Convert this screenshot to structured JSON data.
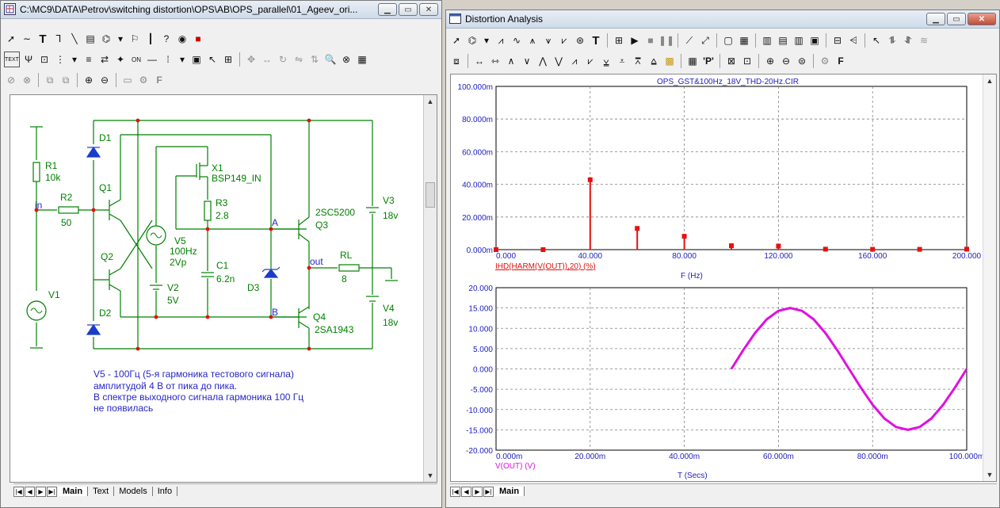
{
  "schematic_window": {
    "title": "C:\\MC9\\DATA\\Petrov\\switching distortion\\OPS\\AB\\OPS_parallel\\01_Ageev_ori...",
    "tabs": [
      "Main",
      "Text",
      "Models",
      "Info"
    ],
    "active_tab": "Main",
    "components": {
      "r1": "R1",
      "r1_val": "10k",
      "r2": "R2",
      "r2_val": "50",
      "d1": "D1",
      "d2": "D2",
      "q1": "Q1",
      "q2": "Q2",
      "x1": "X1",
      "x1_model": "BSP149_IN",
      "r3": "R3",
      "r3_val": "2.8",
      "v5": "V5",
      "v5_freq": "100Hz",
      "v5_amp": "2Vp",
      "v2": "V2",
      "v2_val": "5V",
      "c1": "C1",
      "c1_val": "6.2n",
      "d3": "D3",
      "q3": "Q3",
      "q3_model": "2SC5200",
      "q4": "Q4",
      "q4_model": "2SA1943",
      "v3": "V3",
      "v3_val": "18v",
      "v4": "V4",
      "v4_val": "18v",
      "rl": "RL",
      "rl_val": "8",
      "v1": "V1",
      "node_in": "in",
      "node_out": "out",
      "node_a": "A",
      "node_b": "B"
    },
    "note_lines": [
      "V5 - 100Гц (5-я гармоника тестового сигнала)",
      "амплитудой 4 В от пика до пика.",
      "В спектре выходного сигнала гармоника 100 Гц",
      "не появилась"
    ]
  },
  "analysis_window": {
    "title": "Distortion Analysis",
    "tabs": [
      "Main"
    ],
    "active_tab": "Main"
  },
  "chart_data": [
    {
      "type": "bar",
      "title": "OPS_GST&100Hz_18V_THD-20Hz.CIR",
      "xlabel": "F (Hz)",
      "ylabel": "IHD(HARM(V(OUT)),20) (%)",
      "xlim": [
        0,
        200
      ],
      "ylim": [
        0,
        0.1
      ],
      "x_ticks": [
        "0.000",
        "40.000",
        "80.000",
        "120.000",
        "160.000",
        "200.000"
      ],
      "y_ticks": [
        "0.000m",
        "20.000m",
        "40.000m",
        "60.000m",
        "80.000m",
        "100.000m"
      ],
      "x": [
        0,
        20,
        40,
        60,
        80,
        100,
        120,
        140,
        160,
        180,
        200
      ],
      "values": [
        0.0,
        0.0,
        0.0428,
        0.013,
        0.0082,
        0.0024,
        0.0022,
        0.0003,
        0.0002,
        0.0002,
        0.0003
      ],
      "color": "#e81010",
      "grid": true
    },
    {
      "type": "line",
      "xlabel": "T (Secs)",
      "ylabel": "V(OUT) (V)",
      "xlim": [
        0,
        0.1
      ],
      "ylim": [
        -20,
        20
      ],
      "x_ticks": [
        "0.000m",
        "20.000m",
        "40.000m",
        "60.000m",
        "80.000m",
        "100.000m"
      ],
      "y_ticks": [
        "20.000",
        "15.000",
        "10.000",
        "5.000",
        "0.000",
        "-5.000",
        "-10.000",
        "-15.000",
        "-20.000"
      ],
      "series": [
        {
          "x": [
            0.05,
            0.0525,
            0.055,
            0.0575,
            0.06,
            0.0625,
            0.065,
            0.0675,
            0.07,
            0.0725,
            0.075,
            0.0775,
            0.08,
            0.0825,
            0.085,
            0.0875,
            0.09,
            0.0925,
            0.095,
            0.0975,
            0.1
          ],
          "values": [
            0.0,
            4.6,
            8.8,
            12.2,
            14.3,
            15.0,
            14.3,
            12.2,
            8.8,
            4.6,
            0.0,
            -4.6,
            -8.8,
            -12.2,
            -14.3,
            -15.0,
            -14.3,
            -12.2,
            -8.8,
            -4.6,
            0.0
          ]
        }
      ],
      "color": "#e010e0",
      "grid": true
    }
  ]
}
